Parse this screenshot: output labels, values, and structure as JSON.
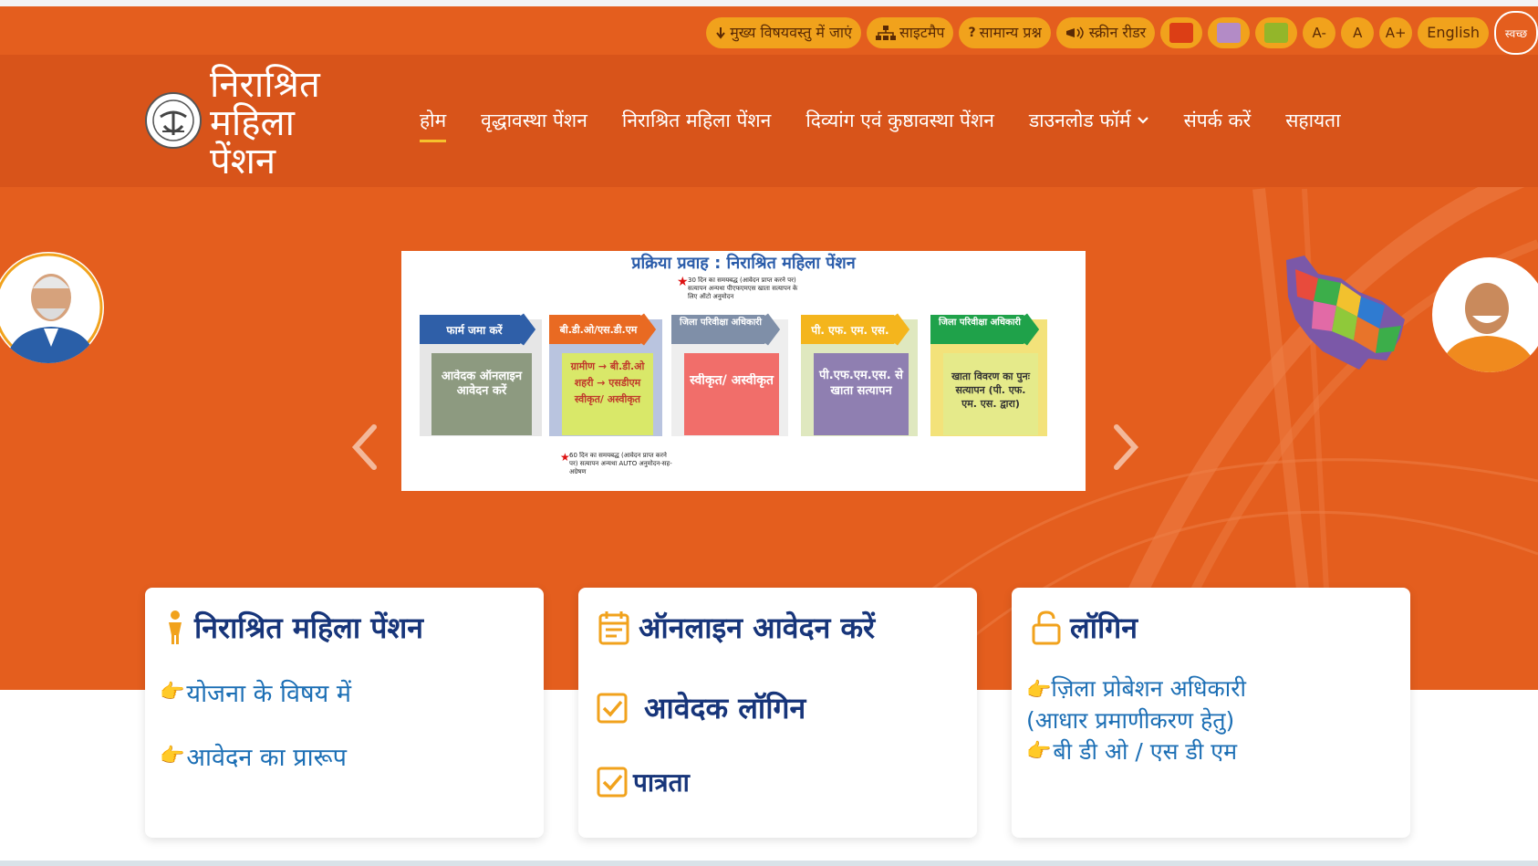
{
  "utility": {
    "skip_main": "मुख्य विषयवस्तु में जाएं",
    "sitemap": "साइटमैप",
    "faq": "सामान्य प्रश्न",
    "screen_reader": "स्क्रीन रीडर",
    "theme_colors": [
      "#dc3e15",
      "#b38bc6",
      "#93b62a"
    ],
    "font_small": "A-",
    "font_normal": "A",
    "font_large": "A+",
    "language": "English",
    "swachh": "स्वच्छ"
  },
  "brand": {
    "line1": "निराश्रित",
    "line2": "महिला",
    "line3": "पेंशन"
  },
  "nav": {
    "home": "होम",
    "old_age": "वृद्धावस्था पेंशन",
    "women": "निराश्रित महिला पेंशन",
    "divyang": "दिव्यांग एवं कुष्ठावस्था पेंशन",
    "download": "डाउनलोड फॉर्म",
    "contact": "संपर्क करें",
    "help": "सहायता"
  },
  "slide": {
    "title": "प्रक्रिया प्रवाह : निराश्रित महिला पेंशन",
    "note_top": "30 दिन का समयबद्ध (आवेदन प्राप्त करने पर) सत्यापन अन्यथा पीएफएमएस खाता सत्यापन के लिए ऑटो अनुमोदन",
    "note_bottom": "60 दिन का समयबद्ध (आवेदन प्राप्त करने पर) सत्यापन अन्यथा AUTO अनुमोदन-सह-अग्रेषण",
    "steps": [
      {
        "header": "फार्म जमा करें",
        "body": "आवेदक ऑनलाइन आवेदन करें"
      },
      {
        "header": "बी.डी.ओ/एस.डी.एम",
        "body": "ग्रामीण → बी.डी.ओ शहरी → एसडीएम स्वीकृत/ अस्वीकृत"
      },
      {
        "header": "जिला परिवीक्षा अधिकारी",
        "body": "स्वीकृत/ अस्वीकृत"
      },
      {
        "header": "पी. एफ. एम. एस.",
        "body": "पी.एफ.एम.एस. से खाता सत्यापन"
      },
      {
        "header": "जिला परिवीक्षा अधिकारी",
        "body": "खाता विवरण का पुनः सत्यापन (पी. एफ. एम. एस. द्वारा)"
      }
    ]
  },
  "cards": {
    "scheme": {
      "title": "निराश्रित महिला पेंशन",
      "link1": "योजना के विषय में",
      "link2": "आवेदन का प्रारूप"
    },
    "online": {
      "title": "ऑनलाइन आवेदन करें",
      "link1": "आवेदक लॉगिन",
      "link2": "पात्रता"
    },
    "login": {
      "title": "लॉगिन",
      "link1": "ज़िला प्रोबेशन अधिकारी (आधार प्रमाणीकरण हेतु)",
      "link2": "बी डी ओ / एस डी एम"
    }
  }
}
